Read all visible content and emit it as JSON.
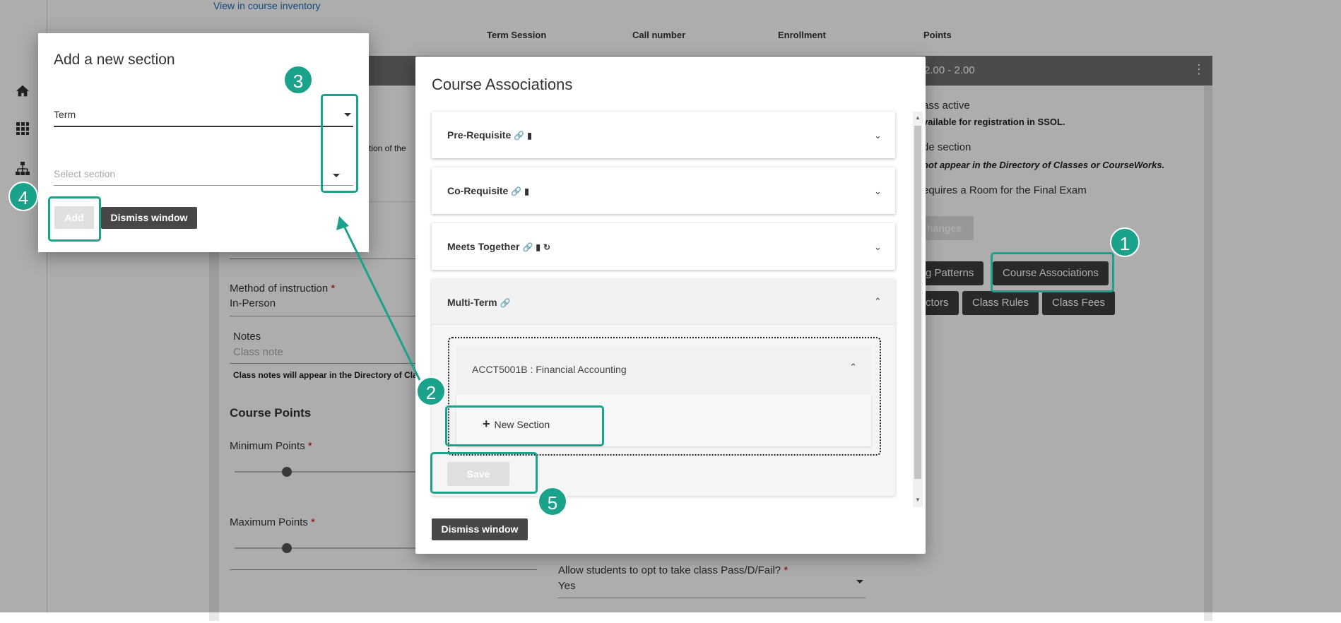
{
  "background": {
    "link": "View in course inventory",
    "columns": [
      "Term Session",
      "Call number",
      "Enrollment",
      "Points"
    ],
    "card_header_points": "2.00  -  2.00",
    "class_active": "ass active",
    "class_active_note": "vailable for registration in SSOL.",
    "hide_section": "de section",
    "hide_section_note": "not appear in the Directory of Classes or CourseWorks.",
    "room_final_exam": "equires a Room for the Final Exam",
    "save_changes": "hanges",
    "section_hint": "ction of the",
    "method_label": "Method of instruction",
    "method_value": "In-Person",
    "notes_label": "Notes",
    "notes_placeholder": "Class note",
    "notes_hint": "Class notes will appear in the Directory of Class",
    "course_points": "Course Points",
    "min_points": "Minimum Points",
    "max_points": "Maximum Points",
    "pass_fail_label": "Allow students to opt to take class Pass/D/Fail?",
    "pass_fail_value": "Yes",
    "required_mark": "*",
    "buttons": {
      "meeting_patterns": "g Patterns",
      "course_associations": "Course Associations",
      "instructors": "ctors",
      "class_rules": "Class Rules",
      "class_fees": "Class Fees"
    }
  },
  "course_associations_modal": {
    "title": "Course Associations",
    "accordions": [
      {
        "label": "Pre-Requisite"
      },
      {
        "label": "Co-Requisite"
      },
      {
        "label": "Meets Together"
      },
      {
        "label": "Multi-Term"
      }
    ],
    "course_row": "ACCT5001B : Financial Accounting",
    "new_section": "New Section",
    "save": "Save",
    "dismiss": "Dismiss window"
  },
  "add_section_modal": {
    "title": "Add a new section",
    "term_value": "Term",
    "section_placeholder": "Select section",
    "add": "Add",
    "dismiss": "Dismiss window"
  },
  "annotations": {
    "badges": [
      "1",
      "2",
      "3",
      "4",
      "5"
    ],
    "accent_color": "#1aa38a"
  },
  "icons": [
    "home-icon",
    "grid-icon",
    "sitemap-icon",
    "link-icon",
    "document-icon",
    "refresh-icon",
    "chevron-down-icon",
    "chevron-up-icon",
    "plus-icon",
    "kebab-menu-icon"
  ]
}
